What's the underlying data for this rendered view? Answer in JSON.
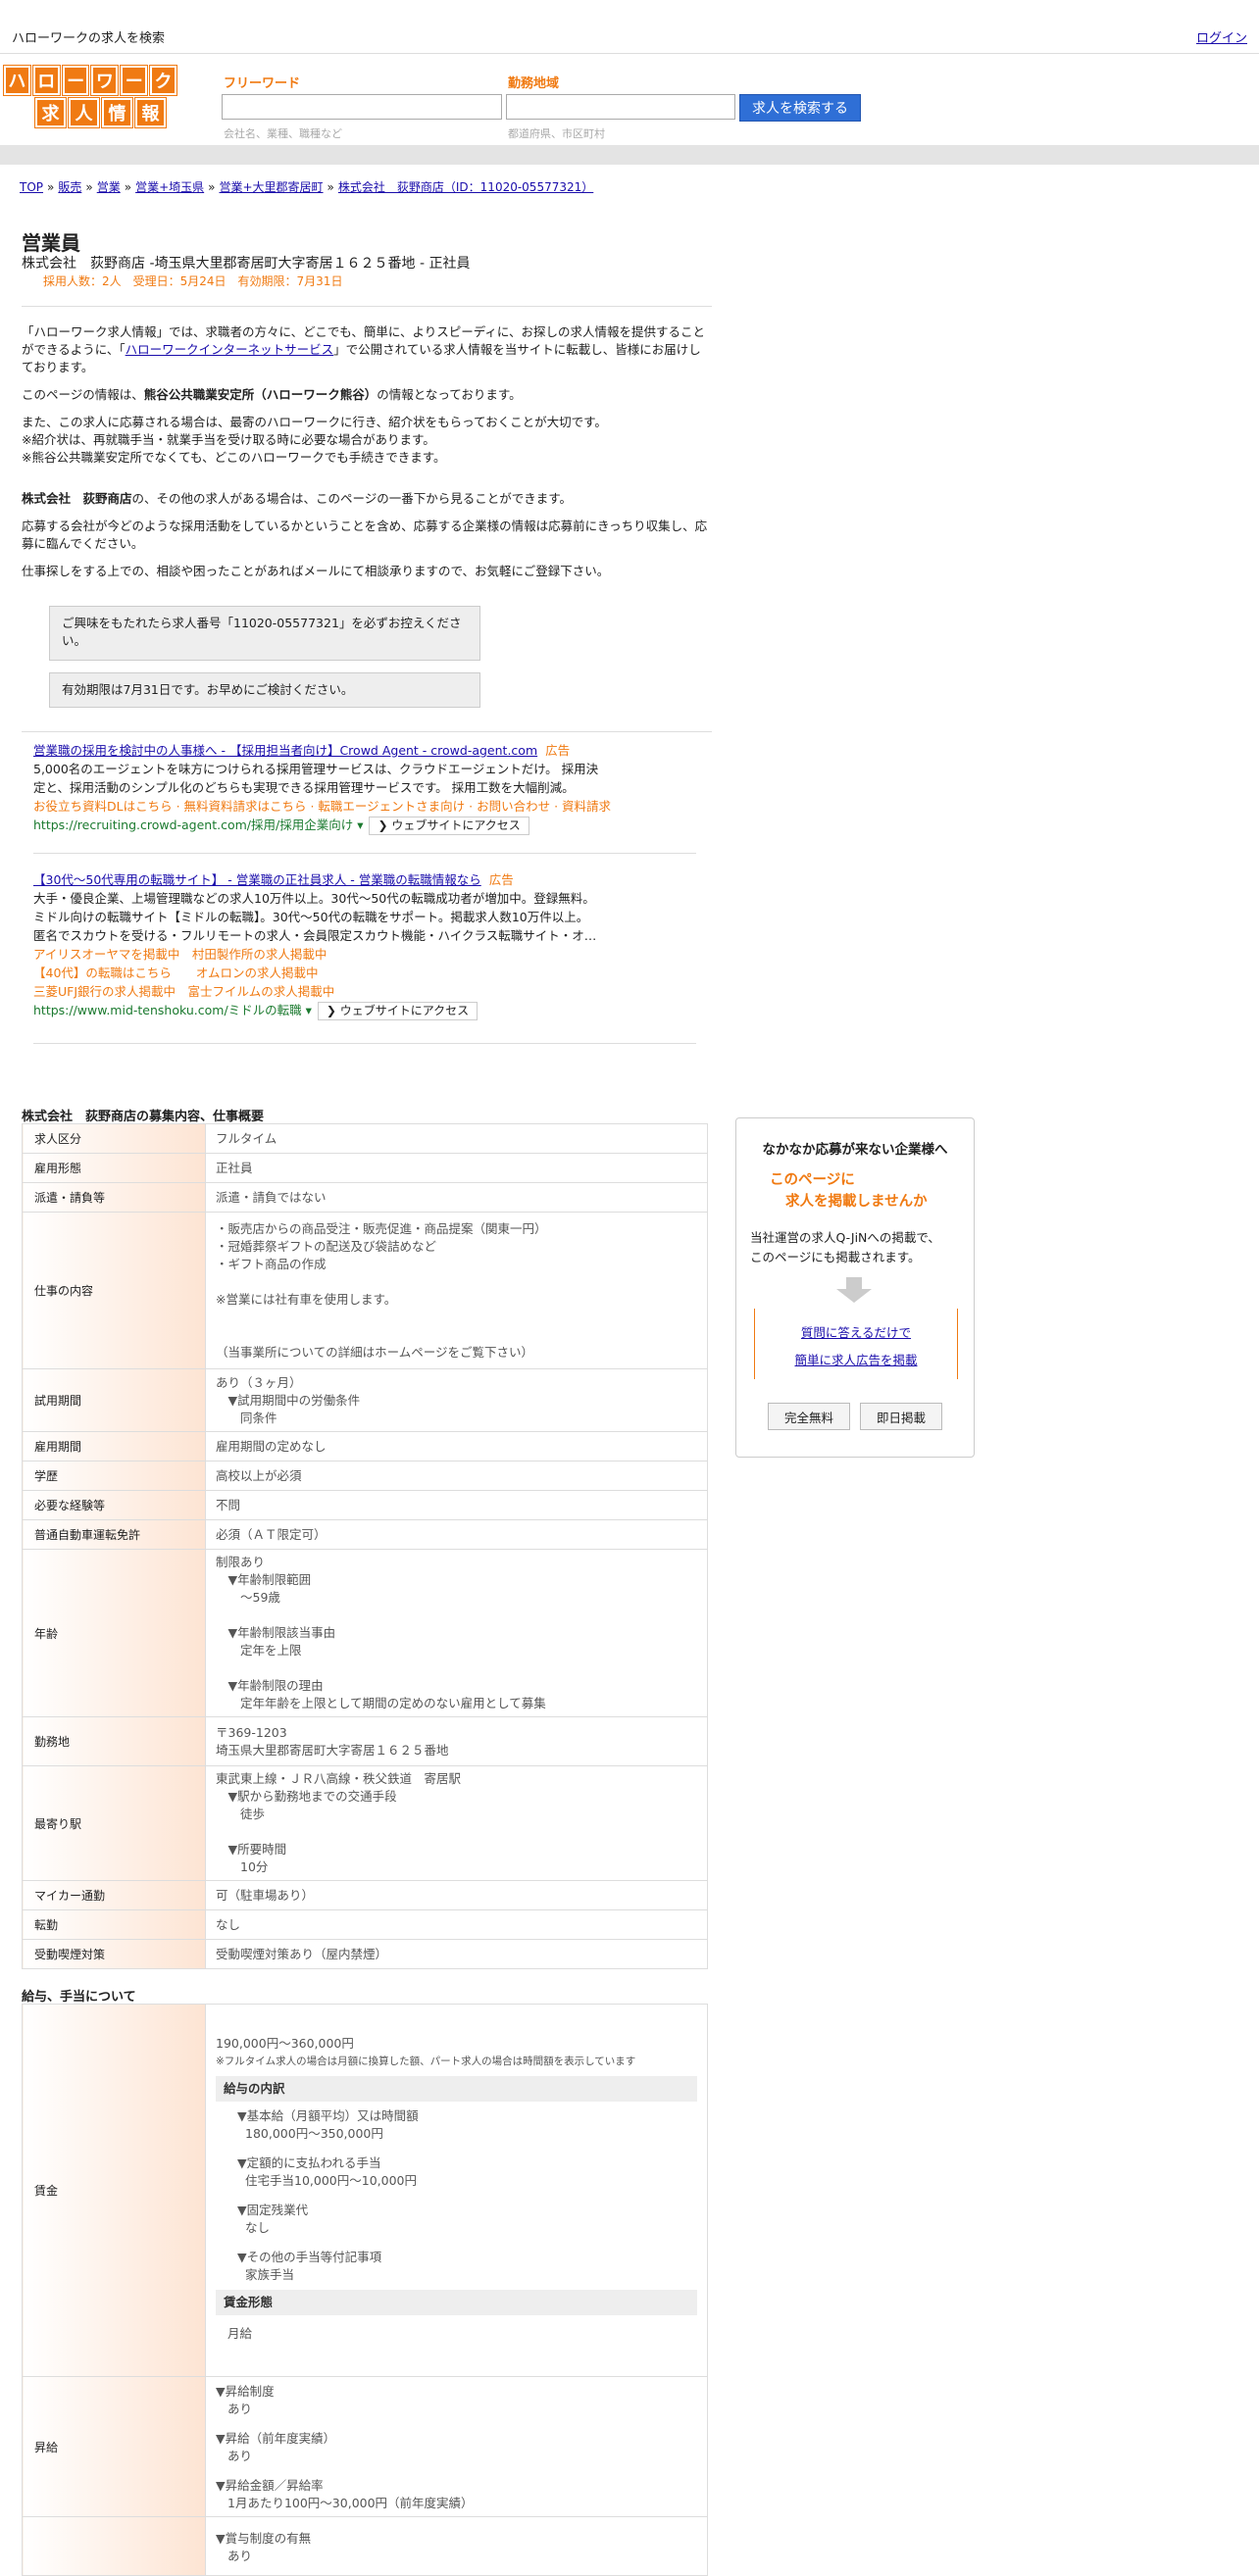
{
  "topbar": {
    "site_title": "ハローワークの求人を検索",
    "login": "ログイン"
  },
  "logo": {
    "row1": [
      "ハ",
      "ロ",
      "ー",
      "ワ",
      "ー",
      "ク"
    ],
    "row2": [
      "求",
      "人",
      "情",
      "報"
    ]
  },
  "search": {
    "free_label": "フリーワード",
    "free_placeholder": "会社名、業種、職種など",
    "area_label": "勤務地域",
    "area_placeholder": "都道府県、市区町村",
    "button": "求人を検索する"
  },
  "breadcrumb": [
    "TOP",
    "販売",
    "営業",
    "営業+埼玉県",
    "営業+大里郡寄居町",
    "株式会社　荻野商店（ID：11020-05577321）"
  ],
  "breadcrumb_sep": "»",
  "job": {
    "title": "営業員",
    "subtitle": "株式会社　荻野商店 -埼玉県大里郡寄居町大字寄居１６２５番地 - 正社員",
    "meta": "採用人数：2人　受理日：5月24日　有効期限：7月31日"
  },
  "intro": {
    "p1_a": "「ハローワーク求人情報」では、求職者の方々に、どこでも、簡単に、よりスピーディに、お探しの求人情報を提供することができるように、「",
    "p1_link": "ハローワークインターネットサービス",
    "p1_b": "」で公開されている求人情報を当サイトに転載し、皆様にお届けしております。",
    "p2_a": "このページの情報は、",
    "p2_bold": "熊谷公共職業安定所（ハローワーク熊谷）",
    "p2_b": "の情報となっております。",
    "p3_l1": "また、この求人に応募される場合は、最寄のハローワークに行き、紹介状をもらっておくことが大切です。",
    "p3_l2": "※紹介状は、再就職手当・就業手当を受け取る時に必要な場合があります。",
    "p3_l3": "※熊谷公共職業安定所でなくても、どこのハローワークでも手続きできます。",
    "p4_bold": "株式会社　荻野商店",
    "p4_b": "の、その他の求人がある場合は、このページの一番下から見ることができます。",
    "p5": "応募する会社が今どのような採用活動をしているかということを含め、応募する企業様の情報は応募前にきっちり収集し、応募に臨んでください。",
    "p6": "仕事探しをする上での、相談や困ったことがあればメールにて相談承りますので、お気軽にご登録下さい。"
  },
  "notes": {
    "n1": "ご興味をもたれたら求人番号「11020-05577321」を必ずお控えください。",
    "n2": "有効期限は7月31日です。お早めにご検討ください。"
  },
  "ads": [
    {
      "title": "営業職の採用を検討中の人事様へ - 【採用担当者向け】Crowd Agent - crowd-agent.com",
      "tag": "広告",
      "desc1": "5,000名のエージェントを味方につけられる採用管理サービスは、クラウドエージェントだけ。 採用決",
      "desc2": "定と、採用活動のシンプル化のどちらも実現できる採用管理サービスです。 採用工数を大幅削減。",
      "orange1": "お役立ち資料DLはこちら · 無料資料請求はこちら · 転職エージェントさま向け · お問い合わせ · 資料請求",
      "url": "https://recruiting.crowd-agent.com/採用/採用企業向け",
      "site_button": "❯ ウェブサイトにアクセス"
    },
    {
      "title": "【30代～50代専用の転職サイト】 - 営業職の正社員求人 - 営業職の転職情報なら",
      "tag": "広告",
      "desc1": "大手・優良企業、上場管理職などの求人10万件以上。30代～50代の転職成功者が増加中。登録無料。",
      "desc2": "ミドル向けの転職サイト【ミドルの転職】。30代～50代の転職をサポート。掲載求人数10万件以上。",
      "desc3": "匿名でスカウトを受ける・フルリモートの求人・会員限定スカウト機能・ハイクラス転職サイト・オ…",
      "orange1": "アイリスオーヤマを掲載中　村田製作所の求人掲載中",
      "orange2": "【40代】の転職はこちら　　オムロンの求人掲載中",
      "orange3": "三菱UFJ銀行の求人掲載中　富士フイルムの求人掲載中",
      "url": "https://www.mid-tenshoku.com/ミドルの転職",
      "site_button": "❯ ウェブサイトにアクセス"
    }
  ],
  "details": {
    "heading": "株式会社　荻野商店の募集内容、仕事概要",
    "rows": [
      {
        "k": "求人区分",
        "v": [
          "フルタイム"
        ]
      },
      {
        "k": "雇用形態",
        "v": [
          "正社員"
        ]
      },
      {
        "k": "派遣・請負等",
        "v": [
          "派遣・請負ではない"
        ]
      },
      {
        "k": "仕事の内容",
        "v": [
          "・販売店からの商品受注・販売促進・商品提案（関東一円）",
          "・冠婚葬祭ギフトの配送及び袋詰めなど",
          "・ギフト商品の作成",
          "",
          "※営業には社有車を使用します。",
          "",
          "",
          "（当事業所についての詳細はホームページをご覧下さい）"
        ]
      },
      {
        "k": "試用期間",
        "v": [
          "あり（３ヶ月）",
          "　▼試用期間中の労働条件",
          "　　同条件"
        ]
      },
      {
        "k": "雇用期間",
        "v": [
          "雇用期間の定めなし"
        ]
      },
      {
        "k": "学歴",
        "v": [
          "高校以上が必須"
        ]
      },
      {
        "k": "必要な経験等",
        "v": [
          "不問"
        ]
      },
      {
        "k": "普通自動車運転免許",
        "v": [
          "必須（ＡＴ限定可）"
        ]
      },
      {
        "k": "年齢",
        "v": [
          "制限あり",
          "　▼年齢制限範囲",
          "　　〜59歳",
          "",
          "　▼年齢制限該当事由",
          "　　定年を上限",
          "",
          "　▼年齢制限の理由",
          "　　定年年齢を上限として期間の定めのない雇用として募集"
        ]
      },
      {
        "k": "勤務地",
        "v": [
          "〒369-1203",
          "埼玉県大里郡寄居町大字寄居１６２５番地"
        ]
      },
      {
        "k": "最寄り駅",
        "v": [
          "東武東上線・ＪＲ八高線・秩父鉄道　寄居駅",
          "　▼駅から勤務地までの交通手段",
          "　　徒歩",
          "",
          "　▼所要時間",
          "　　10分"
        ]
      },
      {
        "k": "マイカー通勤",
        "v": [
          "可（駐車場あり）"
        ]
      },
      {
        "k": "転勤",
        "v": [
          "なし"
        ]
      },
      {
        "k": "受動喫煙対策",
        "v": [
          "受動喫煙対策あり（屋内禁煙）"
        ]
      }
    ]
  },
  "salary": {
    "heading": "給与、手当について",
    "wage_key": "賃金",
    "wage_range": "190,000円〜360,000円",
    "wage_note": "※フルタイム求人の場合は月額に換算した額、パート求人の場合は時間額を表示しています",
    "breakdown_head": "給与の内訳",
    "breakdown": [
      {
        "h": "▼基本給（月額平均）又は時間額",
        "v": "180,000円〜350,000円"
      },
      {
        "h": "▼定額的に支払われる手当",
        "v": "住宅手当10,000円〜10,000円"
      },
      {
        "h": "▼固定残業代",
        "v": "なし"
      },
      {
        "h": "▼その他の手当等付記事項",
        "v": "家族手当"
      }
    ],
    "form_head": "賃金形態",
    "form_value": "月給",
    "raise_key": "昇給",
    "raise": [
      {
        "h": "▼昇給制度",
        "v": "あり"
      },
      {
        "h": "▼昇給（前年度実績）",
        "v": "あり"
      },
      {
        "h": "▼昇給金額／昇給率",
        "v": "1月あたり100円〜30,000円（前年度実績）"
      }
    ],
    "bonus": [
      {
        "h": "▼賞与制度の有無",
        "v": "あり"
      }
    ]
  },
  "sidebar": {
    "title": "なかなか応募が来ない企業様へ",
    "offer_l1": "このページに",
    "offer_l2": "求人を掲載しませんか",
    "desc_l1": "当社運営の求人Q-JiNへの掲載で、",
    "desc_l2": "このページにも掲載されます。",
    "link1": "質問に答えるだけで",
    "link2": "簡単に求人広告を掲載",
    "btn_free": "完全無料",
    "btn_same_day": "即日掲載"
  },
  "colors": {
    "accent": "#f07a12",
    "button_blue": "#2f6fd6",
    "link": "#1a0dab"
  }
}
